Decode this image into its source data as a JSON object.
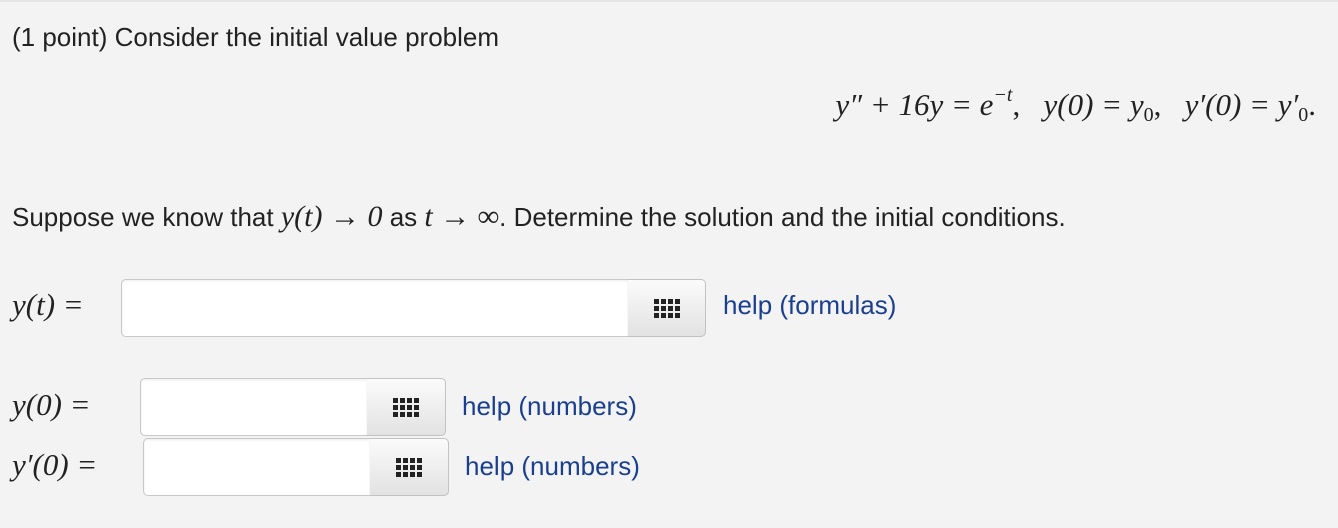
{
  "problem": {
    "intro_text": "(1 point) Consider the initial value problem",
    "equation": {
      "lhs": "y″ + 16y = e",
      "exponent": "−t",
      "cond1": "y(0) = y",
      "cond1_sub": "0",
      "cond2": "y′(0) = y′",
      "cond2_sub": "0"
    },
    "suppose": {
      "before": "Suppose we know that ",
      "math1": "y(t) → 0",
      "mid": " as ",
      "math2": "t → ∞",
      "after": ". Determine the solution and the initial conditions."
    }
  },
  "answers": {
    "y_t": {
      "label": "y(t) =",
      "value": "",
      "help_text": "help (formulas)"
    },
    "y_0": {
      "label": "y(0) =",
      "value": "",
      "help_text": "help (numbers)"
    },
    "yp_0": {
      "label": "y′(0) =",
      "value": "",
      "help_text": "help (numbers)"
    }
  },
  "icons": {
    "palette": "grid-icon"
  },
  "colors": {
    "background": "#f3f3f3",
    "link": "#1a3f8f",
    "text": "#222222"
  }
}
